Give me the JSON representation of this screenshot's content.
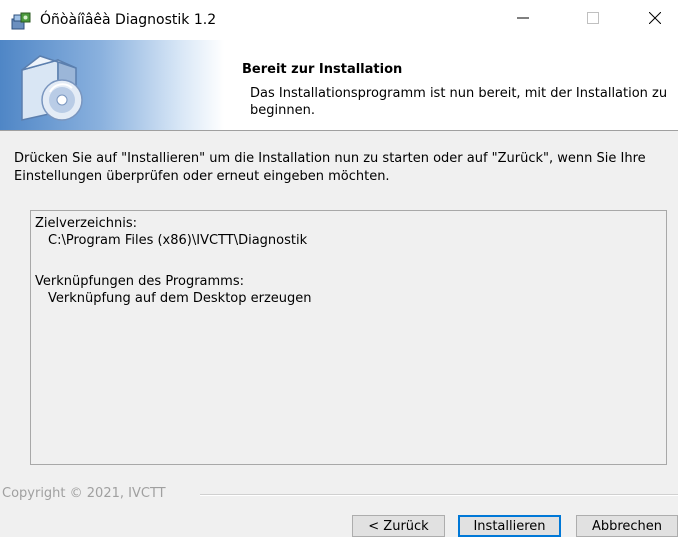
{
  "window": {
    "title": "Óñòàíîâêà Diagnostik 1.2",
    "minimize_label": "—",
    "maximize_label": "☐",
    "close_label": "✕"
  },
  "header": {
    "title": "Bereit zur Installation",
    "subtitle": "Das Installationsprogramm ist nun bereit, mit der Installation zu beginnen."
  },
  "instruction": "Drücken Sie auf \"Installieren\" um die Installation nun zu starten oder auf \"Zurück\", wenn Sie Ihre Einstellungen überprüfen oder erneut eingeben möchten.",
  "summary": {
    "dir_label": "Zielverzeichnis:",
    "dir_value": "C:\\Program Files (x86)\\IVCTT\\Diagnostik",
    "shortcuts_label": "Verknüpfungen des Programms:",
    "shortcuts_value": "Verknüpfung auf dem Desktop erzeugen"
  },
  "copyright": "Copyright © 2021, IVCTT",
  "buttons": {
    "back": "< Zurück",
    "install": "Installieren",
    "cancel": "Abbrechen"
  },
  "icons": {
    "app": "installer-app-icon",
    "header": "software-box-cd-icon"
  },
  "colors": {
    "accent": "#0078d7",
    "banner": "#4f86c6"
  }
}
